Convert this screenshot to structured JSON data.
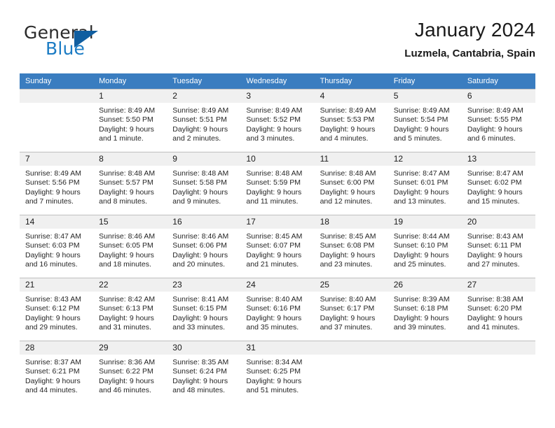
{
  "brand": {
    "name_part1": "General",
    "name_part2": "Blue",
    "flag_icon": "triangle-flag-icon",
    "accent_color": "#1c7cc4",
    "flag_color": "#105ea0"
  },
  "header": {
    "title": "January 2024",
    "subtitle": "Luzmela, Cantabria, Spain"
  },
  "calendar": {
    "header_bg": "#3a7dc0",
    "daynum_bg": "#f0f0f0",
    "border_color": "#bfbfbf",
    "weekday_headers": [
      "Sunday",
      "Monday",
      "Tuesday",
      "Wednesday",
      "Thursday",
      "Friday",
      "Saturday"
    ],
    "weeks": [
      [
        {
          "day": "",
          "sunrise": "",
          "sunset": "",
          "daylight_line1": "",
          "daylight_line2": ""
        },
        {
          "day": "1",
          "sunrise": "Sunrise: 8:49 AM",
          "sunset": "Sunset: 5:50 PM",
          "daylight_line1": "Daylight: 9 hours",
          "daylight_line2": "and 1 minute."
        },
        {
          "day": "2",
          "sunrise": "Sunrise: 8:49 AM",
          "sunset": "Sunset: 5:51 PM",
          "daylight_line1": "Daylight: 9 hours",
          "daylight_line2": "and 2 minutes."
        },
        {
          "day": "3",
          "sunrise": "Sunrise: 8:49 AM",
          "sunset": "Sunset: 5:52 PM",
          "daylight_line1": "Daylight: 9 hours",
          "daylight_line2": "and 3 minutes."
        },
        {
          "day": "4",
          "sunrise": "Sunrise: 8:49 AM",
          "sunset": "Sunset: 5:53 PM",
          "daylight_line1": "Daylight: 9 hours",
          "daylight_line2": "and 4 minutes."
        },
        {
          "day": "5",
          "sunrise": "Sunrise: 8:49 AM",
          "sunset": "Sunset: 5:54 PM",
          "daylight_line1": "Daylight: 9 hours",
          "daylight_line2": "and 5 minutes."
        },
        {
          "day": "6",
          "sunrise": "Sunrise: 8:49 AM",
          "sunset": "Sunset: 5:55 PM",
          "daylight_line1": "Daylight: 9 hours",
          "daylight_line2": "and 6 minutes."
        }
      ],
      [
        {
          "day": "7",
          "sunrise": "Sunrise: 8:49 AM",
          "sunset": "Sunset: 5:56 PM",
          "daylight_line1": "Daylight: 9 hours",
          "daylight_line2": "and 7 minutes."
        },
        {
          "day": "8",
          "sunrise": "Sunrise: 8:48 AM",
          "sunset": "Sunset: 5:57 PM",
          "daylight_line1": "Daylight: 9 hours",
          "daylight_line2": "and 8 minutes."
        },
        {
          "day": "9",
          "sunrise": "Sunrise: 8:48 AM",
          "sunset": "Sunset: 5:58 PM",
          "daylight_line1": "Daylight: 9 hours",
          "daylight_line2": "and 9 minutes."
        },
        {
          "day": "10",
          "sunrise": "Sunrise: 8:48 AM",
          "sunset": "Sunset: 5:59 PM",
          "daylight_line1": "Daylight: 9 hours",
          "daylight_line2": "and 11 minutes."
        },
        {
          "day": "11",
          "sunrise": "Sunrise: 8:48 AM",
          "sunset": "Sunset: 6:00 PM",
          "daylight_line1": "Daylight: 9 hours",
          "daylight_line2": "and 12 minutes."
        },
        {
          "day": "12",
          "sunrise": "Sunrise: 8:47 AM",
          "sunset": "Sunset: 6:01 PM",
          "daylight_line1": "Daylight: 9 hours",
          "daylight_line2": "and 13 minutes."
        },
        {
          "day": "13",
          "sunrise": "Sunrise: 8:47 AM",
          "sunset": "Sunset: 6:02 PM",
          "daylight_line1": "Daylight: 9 hours",
          "daylight_line2": "and 15 minutes."
        }
      ],
      [
        {
          "day": "14",
          "sunrise": "Sunrise: 8:47 AM",
          "sunset": "Sunset: 6:03 PM",
          "daylight_line1": "Daylight: 9 hours",
          "daylight_line2": "and 16 minutes."
        },
        {
          "day": "15",
          "sunrise": "Sunrise: 8:46 AM",
          "sunset": "Sunset: 6:05 PM",
          "daylight_line1": "Daylight: 9 hours",
          "daylight_line2": "and 18 minutes."
        },
        {
          "day": "16",
          "sunrise": "Sunrise: 8:46 AM",
          "sunset": "Sunset: 6:06 PM",
          "daylight_line1": "Daylight: 9 hours",
          "daylight_line2": "and 20 minutes."
        },
        {
          "day": "17",
          "sunrise": "Sunrise: 8:45 AM",
          "sunset": "Sunset: 6:07 PM",
          "daylight_line1": "Daylight: 9 hours",
          "daylight_line2": "and 21 minutes."
        },
        {
          "day": "18",
          "sunrise": "Sunrise: 8:45 AM",
          "sunset": "Sunset: 6:08 PM",
          "daylight_line1": "Daylight: 9 hours",
          "daylight_line2": "and 23 minutes."
        },
        {
          "day": "19",
          "sunrise": "Sunrise: 8:44 AM",
          "sunset": "Sunset: 6:10 PM",
          "daylight_line1": "Daylight: 9 hours",
          "daylight_line2": "and 25 minutes."
        },
        {
          "day": "20",
          "sunrise": "Sunrise: 8:43 AM",
          "sunset": "Sunset: 6:11 PM",
          "daylight_line1": "Daylight: 9 hours",
          "daylight_line2": "and 27 minutes."
        }
      ],
      [
        {
          "day": "21",
          "sunrise": "Sunrise: 8:43 AM",
          "sunset": "Sunset: 6:12 PM",
          "daylight_line1": "Daylight: 9 hours",
          "daylight_line2": "and 29 minutes."
        },
        {
          "day": "22",
          "sunrise": "Sunrise: 8:42 AM",
          "sunset": "Sunset: 6:13 PM",
          "daylight_line1": "Daylight: 9 hours",
          "daylight_line2": "and 31 minutes."
        },
        {
          "day": "23",
          "sunrise": "Sunrise: 8:41 AM",
          "sunset": "Sunset: 6:15 PM",
          "daylight_line1": "Daylight: 9 hours",
          "daylight_line2": "and 33 minutes."
        },
        {
          "day": "24",
          "sunrise": "Sunrise: 8:40 AM",
          "sunset": "Sunset: 6:16 PM",
          "daylight_line1": "Daylight: 9 hours",
          "daylight_line2": "and 35 minutes."
        },
        {
          "day": "25",
          "sunrise": "Sunrise: 8:40 AM",
          "sunset": "Sunset: 6:17 PM",
          "daylight_line1": "Daylight: 9 hours",
          "daylight_line2": "and 37 minutes."
        },
        {
          "day": "26",
          "sunrise": "Sunrise: 8:39 AM",
          "sunset": "Sunset: 6:18 PM",
          "daylight_line1": "Daylight: 9 hours",
          "daylight_line2": "and 39 minutes."
        },
        {
          "day": "27",
          "sunrise": "Sunrise: 8:38 AM",
          "sunset": "Sunset: 6:20 PM",
          "daylight_line1": "Daylight: 9 hours",
          "daylight_line2": "and 41 minutes."
        }
      ],
      [
        {
          "day": "28",
          "sunrise": "Sunrise: 8:37 AM",
          "sunset": "Sunset: 6:21 PM",
          "daylight_line1": "Daylight: 9 hours",
          "daylight_line2": "and 44 minutes."
        },
        {
          "day": "29",
          "sunrise": "Sunrise: 8:36 AM",
          "sunset": "Sunset: 6:22 PM",
          "daylight_line1": "Daylight: 9 hours",
          "daylight_line2": "and 46 minutes."
        },
        {
          "day": "30",
          "sunrise": "Sunrise: 8:35 AM",
          "sunset": "Sunset: 6:24 PM",
          "daylight_line1": "Daylight: 9 hours",
          "daylight_line2": "and 48 minutes."
        },
        {
          "day": "31",
          "sunrise": "Sunrise: 8:34 AM",
          "sunset": "Sunset: 6:25 PM",
          "daylight_line1": "Daylight: 9 hours",
          "daylight_line2": "and 51 minutes."
        },
        {
          "day": "",
          "sunrise": "",
          "sunset": "",
          "daylight_line1": "",
          "daylight_line2": ""
        },
        {
          "day": "",
          "sunrise": "",
          "sunset": "",
          "daylight_line1": "",
          "daylight_line2": ""
        },
        {
          "day": "",
          "sunrise": "",
          "sunset": "",
          "daylight_line1": "",
          "daylight_line2": ""
        }
      ]
    ]
  }
}
